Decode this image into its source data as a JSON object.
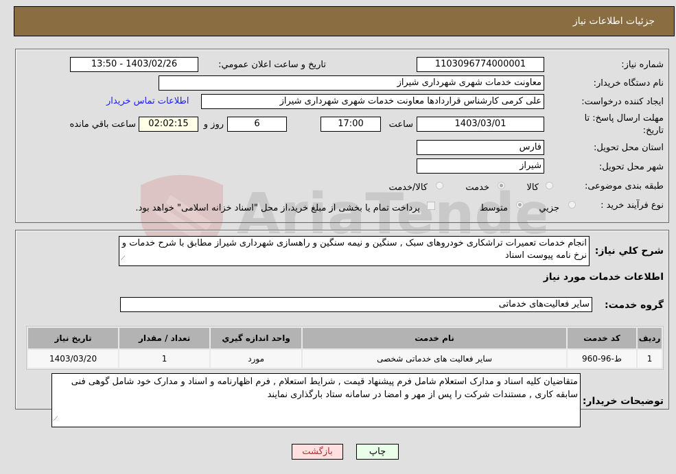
{
  "header": {
    "title": "جزئیات اطلاعات نیاز"
  },
  "form": {
    "need_number": {
      "label": "شماره نیاز:",
      "value": "1103096774000001"
    },
    "announce_datetime": {
      "label": "تاریخ و ساعت اعلان عمومي:",
      "value": "1403/02/26 - 13:50"
    },
    "buyer_org": {
      "label": "نام دستگاه خريدار:",
      "value": "معاونت خدمات شهری شهرداری شیراز"
    },
    "requester": {
      "label": "ایجاد کننده درخواست:",
      "value": "علی کرمی کارشناس قراردادها معاونت خدمات شهری شهرداری شیراز"
    },
    "contact_link": "اطلاعات تماس خريدار",
    "deadline": {
      "label_line1": "مهلت ارسال پاسخ: تا",
      "label_line2": "تاريخ:",
      "date": "1403/03/01",
      "time_label": "ساعت",
      "time": "17:00",
      "days": "6",
      "days_label": "روز و",
      "remaining": "02:02:15",
      "remaining_label": "ساعت باقي مانده"
    },
    "province": {
      "label": "استان محل تحویل:",
      "value": "فارس"
    },
    "city": {
      "label": "شهر محل تحویل:",
      "value": "شیراز"
    },
    "category": {
      "label": "طبقه بندی موضوعی:",
      "options": [
        "کالا",
        "خدمت",
        "کالا/خدمت"
      ],
      "selected": "خدمت"
    },
    "process_type": {
      "label": "نوع فرآیند خرید :",
      "options": [
        "جزيي",
        "متوسط"
      ],
      "selected": "متوسط",
      "payment_note": "پرداخت تمام یا بخشی از مبلغ خرید،از محل \"اسناد خزانه اسلامی\" خواهد بود."
    }
  },
  "details": {
    "summary_label": "شرح كلي نياز:",
    "summary_text": "انجام خدمات تعمیرات تراشکاری خودروهای سبک , سنگین و نیمه سنگین و راهسازی شهرداری شیراز مطابق با شرح خدمات و نرخ نامه پیوست اسناد",
    "services_heading": "اطلاعات خدمات مورد نیاز",
    "service_group_label": "گروه خدمت:",
    "service_group_value": "سایر فعالیت‌های خدماتی",
    "table": {
      "headers": [
        "رديف",
        "كد خدمت",
        "نام خدمت",
        "واحد اندازه گيري",
        "تعداد / مقدار",
        "تاريخ نياز"
      ],
      "rows": [
        [
          "1",
          "ط-96-960",
          "سایر فعالیت های خدماتی شخصی",
          "مورد",
          "1",
          "1403/03/20"
        ]
      ]
    },
    "buyer_notes_label": "توضيحات خريدار:",
    "buyer_notes_text": "متقاضیان کلیه اسناد و مدارک استعلام شامل فرم پیشنهاد قیمت , شرایط استعلام , فرم اظهارنامه و اسناد و مدارک خود شامل گوهی فنی سابقه کاری , مستندات شرکت را پس از مهر و امضا در سامانه ستاد بارگذاری نمایند"
  },
  "buttons": {
    "print": "چاپ",
    "back": "بازگشت"
  },
  "colors": {
    "header_bg": "#8b6d42",
    "print_bg": "#eaffea",
    "back_bg": "#ffe0e0",
    "link": "#1a1aff"
  },
  "watermark": "AriaTender.neT"
}
